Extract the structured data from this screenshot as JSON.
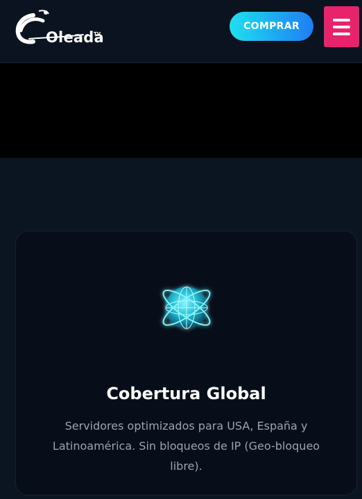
{
  "header": {
    "logo_text": "Oleada",
    "logo_badge": "TV",
    "buy_label": "COMPRAR",
    "menu_icon": "hamburger-icon",
    "colors": {
      "buy_gradient_start": "#1ee0f0",
      "buy_gradient_end": "#1e7ef2",
      "menu_bg": "#e8236c"
    }
  },
  "feature": {
    "icon": "globe-icon",
    "title": "Cobertura Global",
    "description": "Servidores optimizados para USA, España y Latinoamérica. Sin bloqueos de IP (Geo-bloqueo libre)."
  }
}
